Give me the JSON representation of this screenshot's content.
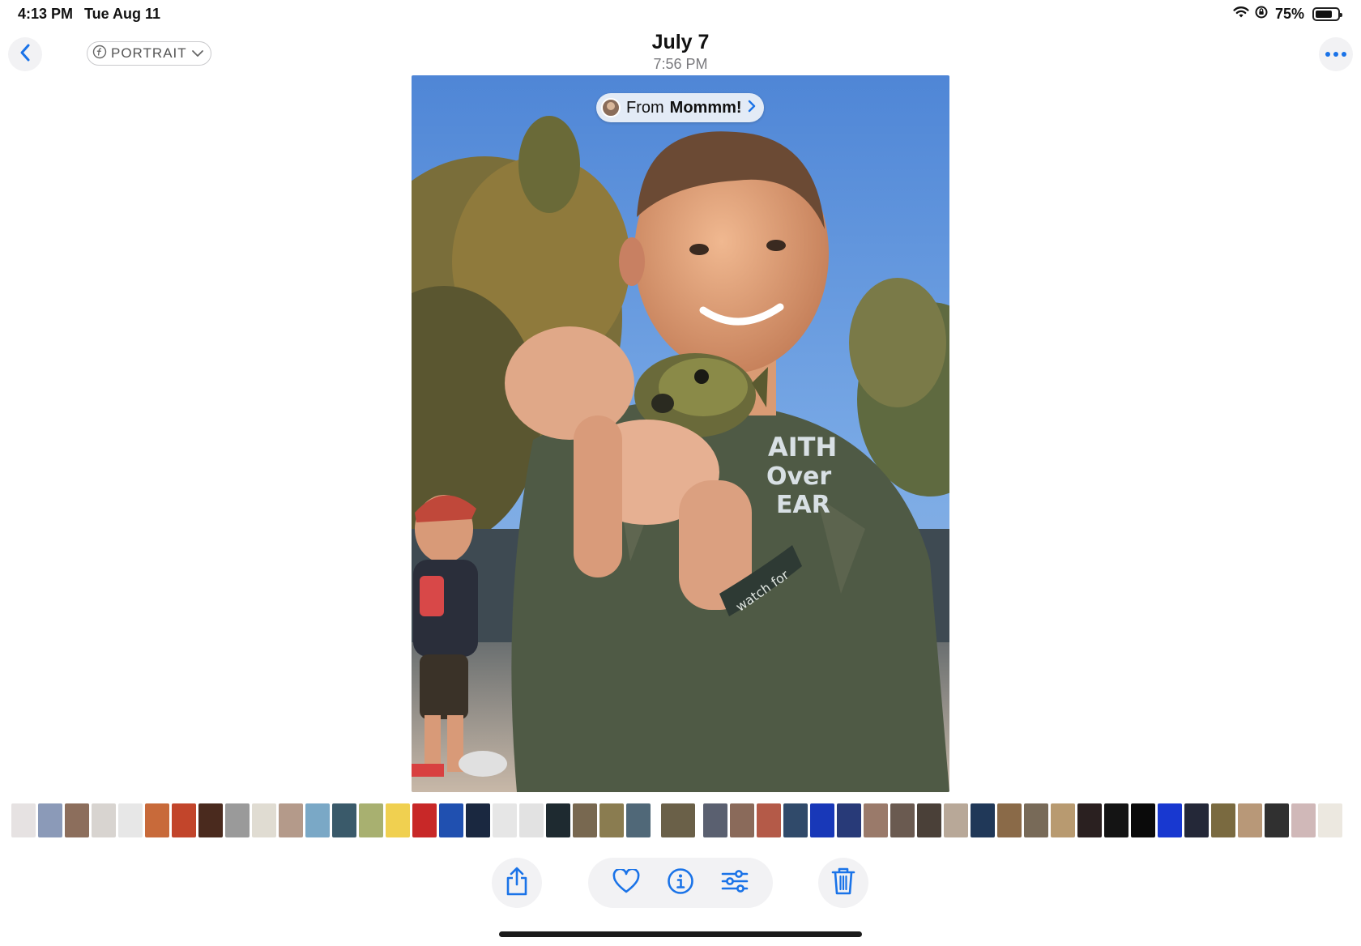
{
  "status_bar": {
    "time": "4:13 PM",
    "date": "Tue Aug 11",
    "battery_percent": "75%",
    "battery_level": 0.75,
    "icons": [
      "wifi-icon",
      "orientation-lock-icon",
      "battery-icon"
    ]
  },
  "nav": {
    "back_icon": "chevron-left-icon",
    "portrait_label": "PORTRAIT",
    "title_date": "July 7",
    "title_time": "7:56 PM",
    "more_icon": "ellipsis-icon"
  },
  "photo": {
    "shared_prefix": "From",
    "shared_name": "Mommm!",
    "description_colors": {
      "sky": "#5b8fd8",
      "trees": "#6b6a3a",
      "shirt": "#4f5a45"
    }
  },
  "toolbar": {
    "share_icon": "share-icon",
    "favorite_icon": "heart-icon",
    "info_icon": "info-icon",
    "adjust_icon": "adjust-icon",
    "delete_icon": "trash-icon"
  },
  "colors": {
    "accent": "#1a73e8",
    "button_bg": "#f2f2f4"
  },
  "thumbnails": [
    "#e6e2e2",
    "#8b9ab8",
    "#8c6e5c",
    "#d8d4d0",
    "#e7e7e7",
    "#c86a3a",
    "#c2452b",
    "#4a2a1e",
    "#9a9a9a",
    "#e0dcd2",
    "#b49a8a",
    "#7aa8c6",
    "#3a5a6a",
    "#a8b070",
    "#f0d050",
    "#c82828",
    "#2050b0",
    "#1a2840",
    "#e6e6e6",
    "#e2e2e2",
    "#1e2a30",
    "#786850",
    "#8a7c50",
    "#506878",
    "#6a6048",
    "#5a6070",
    "#8a6a5a",
    "#b45a48",
    "#304a6a",
    "#1838b8",
    "#283a78",
    "#9a7a6a",
    "#6a5a50",
    "#4a4038",
    "#b8a898",
    "#203858",
    "#8a6a48",
    "#786a58",
    "#b89a70",
    "#2a2020",
    "#141414",
    "#0a0a0a",
    "#1838d0",
    "#242838",
    "#7a6a40",
    "#b89878",
    "#303030",
    "#d0b8b8",
    "#ece8e0"
  ]
}
